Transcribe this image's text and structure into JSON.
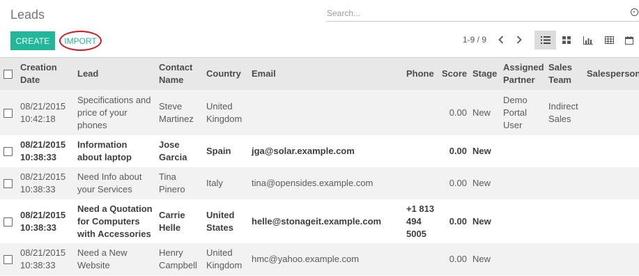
{
  "header": {
    "title": "Leads",
    "search_placeholder": "Search..."
  },
  "toolbar": {
    "create_label": "CREATE",
    "import_label": "IMPORT",
    "pager_text": "1-9 / 9"
  },
  "table": {
    "columns": [
      "Creation Date",
      "Lead",
      "Contact Name",
      "Country",
      "Email",
      "Phone",
      "Score",
      "Stage",
      "Assigned Partner",
      "Sales Team",
      "Salesperson"
    ],
    "rows": [
      {
        "date": "08/21/2015 10:42:18",
        "lead": "Specifications and price of your phones",
        "contact": "Steve Martinez",
        "country": "United Kingdom",
        "email": "",
        "phone": "",
        "score": "0.00",
        "stage": "New",
        "partner": "Demo Portal User",
        "team": "Indirect Sales",
        "salesperson": "",
        "bold": false
      },
      {
        "date": "08/21/2015 10:38:33",
        "lead": "Information about laptop",
        "contact": "Jose Garcia",
        "country": "Spain",
        "email": "jga@solar.example.com",
        "phone": "",
        "score": "0.00",
        "stage": "New",
        "partner": "",
        "team": "",
        "salesperson": "",
        "bold": true
      },
      {
        "date": "08/21/2015 10:38:33",
        "lead": "Need Info about your Services",
        "contact": "Tina Pinero",
        "country": "Italy",
        "email": "tina@opensides.example.com",
        "phone": "",
        "score": "0.00",
        "stage": "New",
        "partner": "",
        "team": "",
        "salesperson": "",
        "bold": false
      },
      {
        "date": "08/21/2015 10:38:33",
        "lead": "Need a Quotation for Computers with Accessories",
        "contact": "Carrie Helle",
        "country": "United States",
        "email": "helle@stonageit.example.com",
        "phone": "+1 813 494 5005",
        "score": "0.00",
        "stage": "New",
        "partner": "",
        "team": "",
        "salesperson": "",
        "bold": true
      },
      {
        "date": "08/21/2015 10:38:33",
        "lead": "Need a New Website",
        "contact": "Henry Campbell",
        "country": "United Kingdom",
        "email": "hmc@yahoo.example.com",
        "phone": "",
        "score": "0.00",
        "stage": "New",
        "partner": "",
        "team": "",
        "salesperson": "",
        "bold": false
      }
    ]
  },
  "colors": {
    "accent": "#21b799",
    "highlight_circle": "#d9141c"
  }
}
